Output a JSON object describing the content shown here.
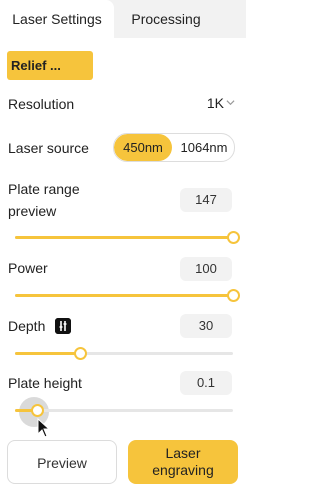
{
  "tabs": [
    {
      "label": "Laser Settings",
      "active": true
    },
    {
      "label": "Processing",
      "active": false
    }
  ],
  "mode": {
    "label": "Relief ..."
  },
  "resolution": {
    "label": "Resolution",
    "value": "1K"
  },
  "laser_source": {
    "label": "Laser source",
    "options": [
      "450nm",
      "1064nm"
    ],
    "selected": "450nm"
  },
  "plate_range": {
    "label_line1": "Plate range",
    "label_line2": "preview",
    "value": "147",
    "level": 1.0
  },
  "power": {
    "label": "Power",
    "value": "100",
    "level": 1.0
  },
  "depth": {
    "label": "Depth",
    "value": "30",
    "level": 0.3
  },
  "plate_height": {
    "label": "Plate height",
    "value": "0.1",
    "level": 0.1
  },
  "buttons": {
    "preview": "Preview",
    "engrave_line1": "Laser",
    "engrave_line2": "engraving"
  },
  "colors": {
    "accent": "#f6c43c",
    "track": "#e6e6e6",
    "value_bg": "#f2f2f2"
  },
  "icons": {
    "dropdown": "chevron-down-icon",
    "depth_info": "depth-adjust-icon",
    "cursor": "mouse-pointer-icon"
  }
}
